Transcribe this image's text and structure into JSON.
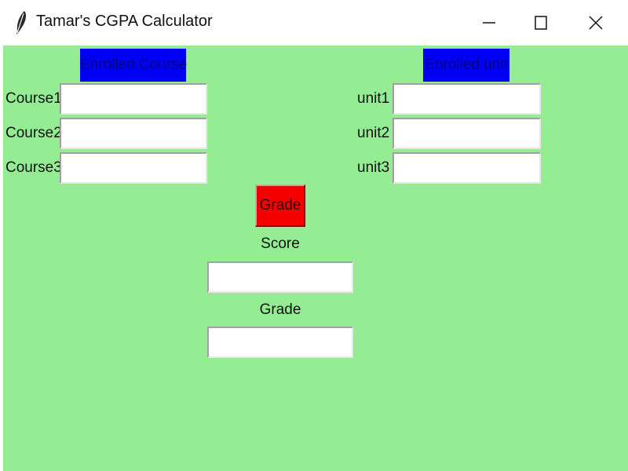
{
  "window": {
    "title": "Tamar's CGPA Calculator",
    "icon": "feather-icon",
    "controls": {
      "minimize_icon": "minimize-icon",
      "maximize_icon": "maximize-icon",
      "close_icon": "close-icon"
    }
  },
  "colors": {
    "background": "#94ed92",
    "header_label": "#0000f5",
    "grade_button": "#f40000"
  },
  "courses": {
    "header": "Enrolled Course",
    "fields": [
      {
        "label": "Course1",
        "value": ""
      },
      {
        "label": "Course2",
        "value": ""
      },
      {
        "label": "Course3",
        "value": ""
      }
    ]
  },
  "units": {
    "header": "Enrolled unit",
    "fields": [
      {
        "label": "unit1",
        "value": ""
      },
      {
        "label": "unit2",
        "value": ""
      },
      {
        "label": "unit3",
        "value": ""
      }
    ]
  },
  "grade_button": {
    "label": "Grade"
  },
  "score": {
    "label": "Score",
    "value": ""
  },
  "grade": {
    "label": "Grade",
    "value": ""
  }
}
